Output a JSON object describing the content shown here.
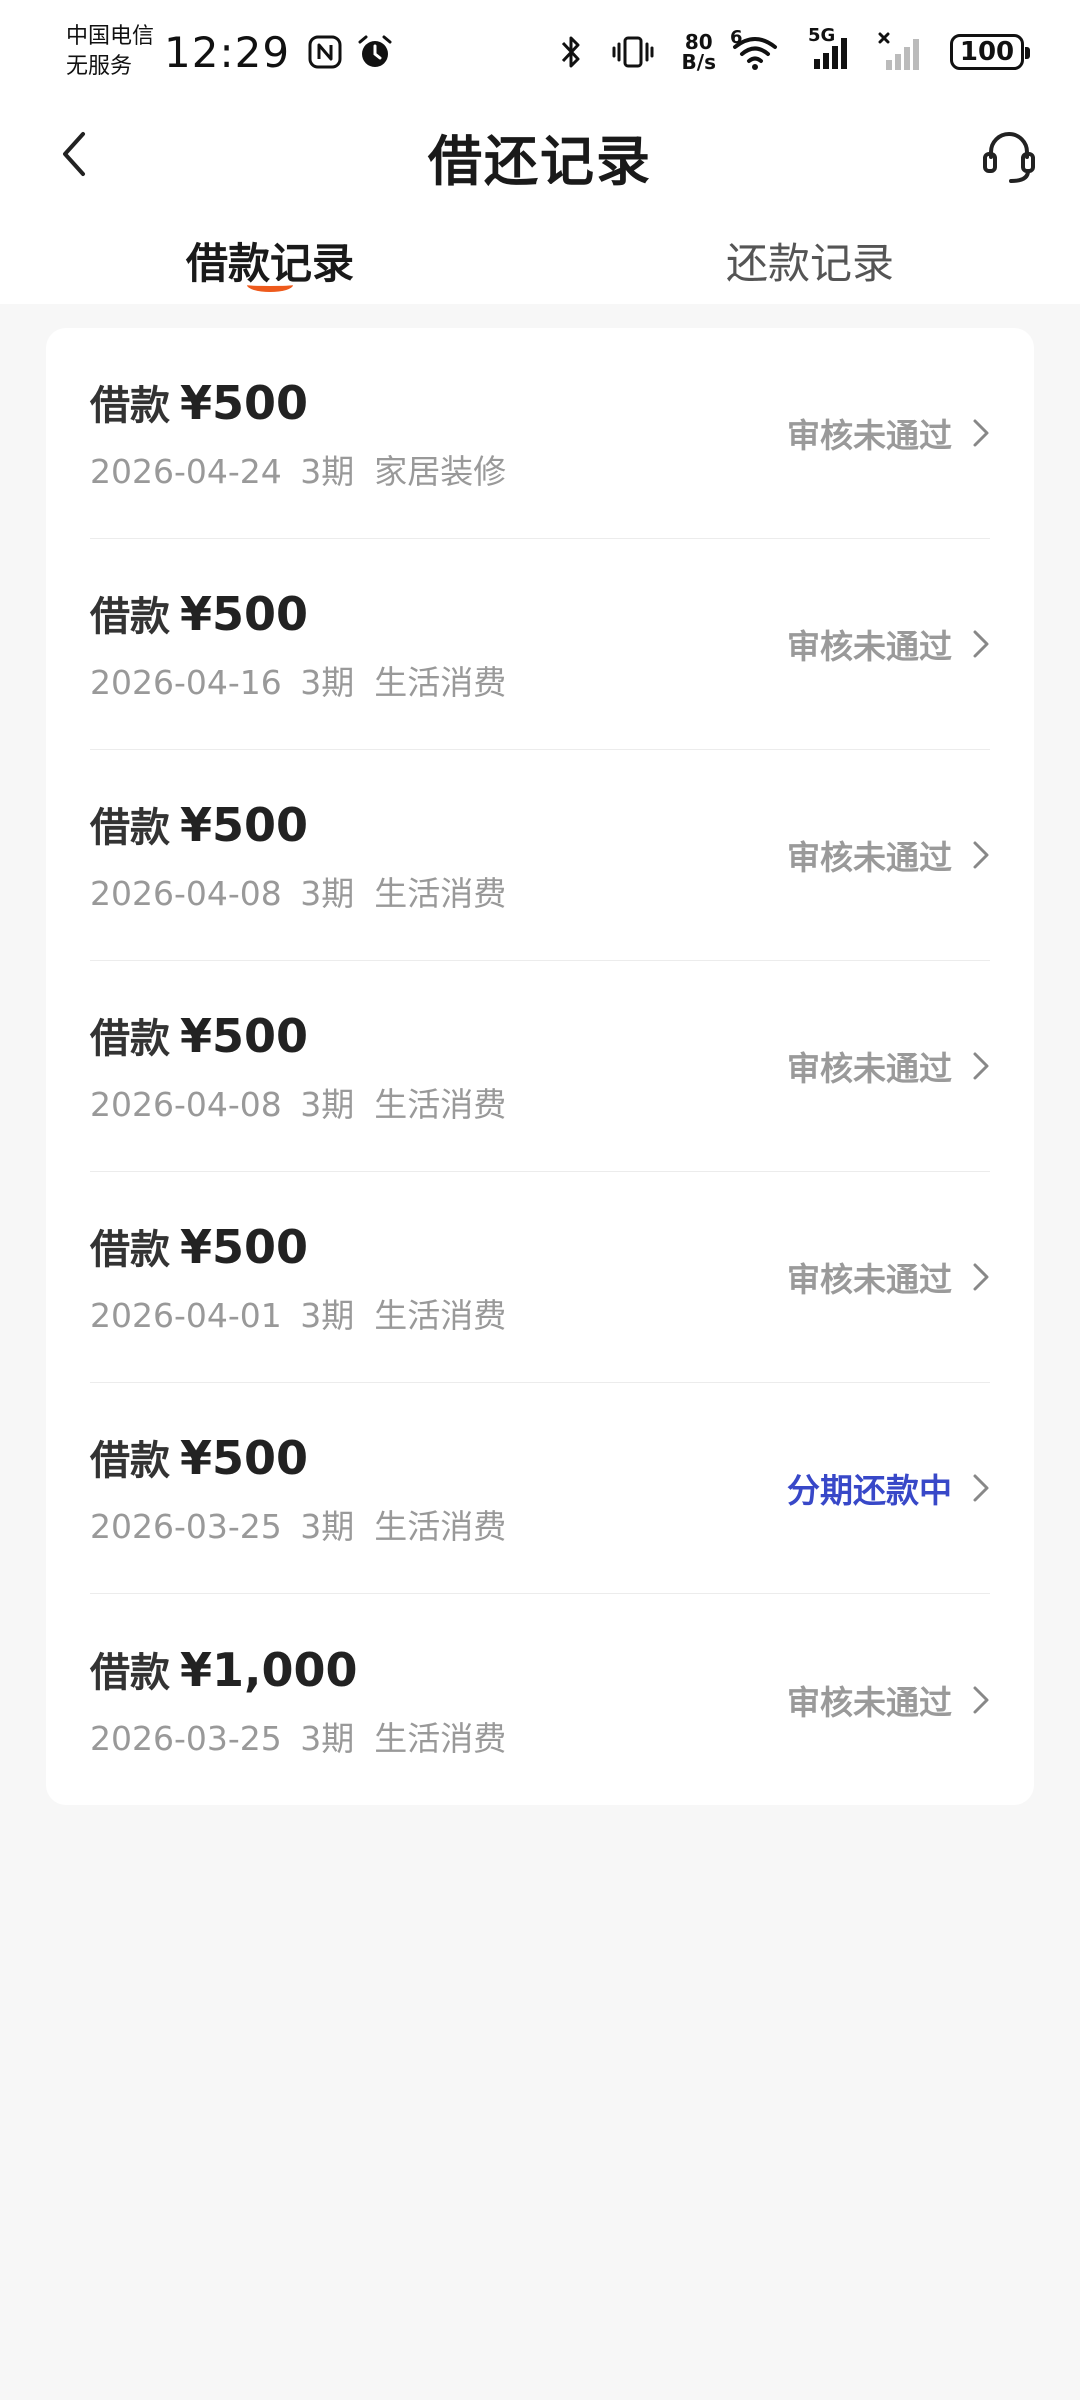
{
  "status_bar": {
    "carrier_line1": "中国电信",
    "carrier_line2": "无服务",
    "time": "12:29",
    "speed_value": "80",
    "speed_unit": "B/s",
    "wifi_badge": "6",
    "network_badge": "5G",
    "battery": "100"
  },
  "header": {
    "title": "借还记录"
  },
  "tabs": [
    {
      "label": "借款记录",
      "active": true
    },
    {
      "label": "还款记录",
      "active": false
    }
  ],
  "loans": [
    {
      "label": "借款",
      "amount": "¥500",
      "date": "2026-04-24",
      "term": "3期",
      "purpose": "家居装修",
      "status": "审核未通过",
      "status_color": "#9a9a9a"
    },
    {
      "label": "借款",
      "amount": "¥500",
      "date": "2026-04-16",
      "term": "3期",
      "purpose": "生活消费",
      "status": "审核未通过",
      "status_color": "#9a9a9a"
    },
    {
      "label": "借款",
      "amount": "¥500",
      "date": "2026-04-08",
      "term": "3期",
      "purpose": "生活消费",
      "status": "审核未通过",
      "status_color": "#9a9a9a"
    },
    {
      "label": "借款",
      "amount": "¥500",
      "date": "2026-04-08",
      "term": "3期",
      "purpose": "生活消费",
      "status": "审核未通过",
      "status_color": "#9a9a9a"
    },
    {
      "label": "借款",
      "amount": "¥500",
      "date": "2026-04-01",
      "term": "3期",
      "purpose": "生活消费",
      "status": "审核未通过",
      "status_color": "#9a9a9a"
    },
    {
      "label": "借款",
      "amount": "¥500",
      "date": "2026-03-25",
      "term": "3期",
      "purpose": "生活消费",
      "status": "分期还款中",
      "status_color": "#3848c8"
    },
    {
      "label": "借款",
      "amount": "¥1,000",
      "date": "2026-03-25",
      "term": "3期",
      "purpose": "生活消费",
      "status": "审核未通过",
      "status_color": "#9a9a9a"
    }
  ],
  "colors": {
    "accent": "#ee5a1c",
    "status_gray": "#9a9a9a",
    "status_blue": "#3848c8",
    "background": "#f7f7f7"
  },
  "icons": {
    "back": "chevron-left-icon",
    "support": "headset-icon",
    "row_chevron": "chevron-right-icon"
  }
}
